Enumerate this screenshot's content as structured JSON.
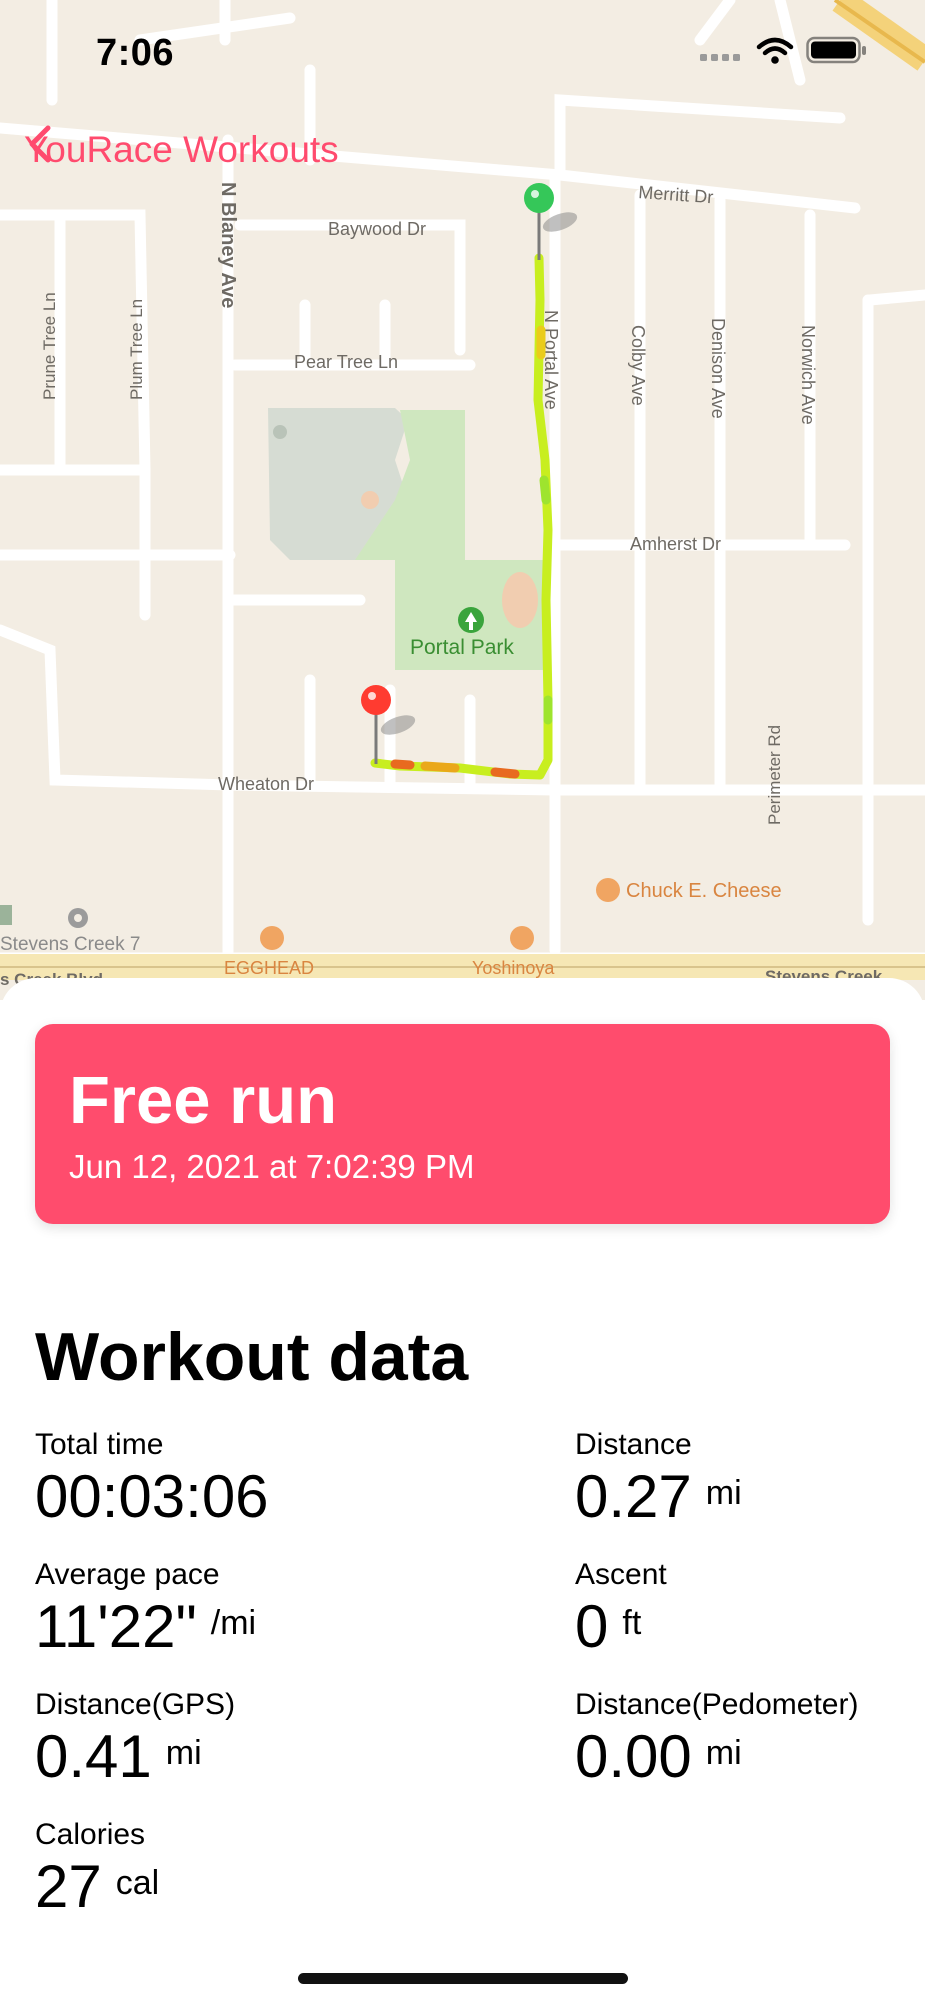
{
  "status_bar": {
    "time": "7:06"
  },
  "nav": {
    "back_label": "YouRace Workouts"
  },
  "map": {
    "streets": {
      "merritt": "Merritt Dr",
      "baywood": "Baywood Dr",
      "pear_tree": "Pear Tree Ln",
      "amherst": "Amherst Dr",
      "wheaton": "Wheaton Dr",
      "n_blaney": "N Blaney Ave",
      "n_portal": "N Portal Ave",
      "colby": "Colby Ave",
      "denison": "Denison Ave",
      "norwich": "Norwich Ave",
      "prune_tree": "Prune Tree Ln",
      "plum_tree": "Plum Tree Ln",
      "perimeter": "Perimeter Rd",
      "stevens_creek_left": "s Creek Blvd",
      "stevens_creek_right": "Stevens Creek"
    },
    "pois": {
      "park": "Portal Park",
      "chuck": "Chuck E. Cheese",
      "stevens7": "Stevens Creek 7",
      "egghead": "EGGHEAD",
      "yoshinoya": "Yoshinoya"
    },
    "colors": {
      "route_main": "#c8ee1f",
      "route_hot": "#e86a1f",
      "start_pin": "#35c759",
      "end_pin": "#ff3b30",
      "park": "#cfe7bf"
    }
  },
  "workout": {
    "title": "Free run",
    "date": "Jun 12, 2021 at 7:02:39 PM",
    "banner_color": "#ff4c6d"
  },
  "section_title": "Workout data",
  "metrics": {
    "total_time": {
      "label": "Total time",
      "value": "00:03:06",
      "unit": ""
    },
    "distance": {
      "label": "Distance",
      "value": "0.27",
      "unit": "mi"
    },
    "average_pace": {
      "label": "Average pace",
      "value": "11'22\"",
      "unit": "/mi"
    },
    "ascent": {
      "label": "Ascent",
      "value": "0",
      "unit": "ft"
    },
    "distance_gps": {
      "label": "Distance(GPS)",
      "value": "0.41",
      "unit": "mi"
    },
    "distance_pedometer": {
      "label": "Distance(Pedometer)",
      "value": "0.00",
      "unit": "mi"
    },
    "calories": {
      "label": "Calories",
      "value": "27",
      "unit": "cal"
    }
  }
}
